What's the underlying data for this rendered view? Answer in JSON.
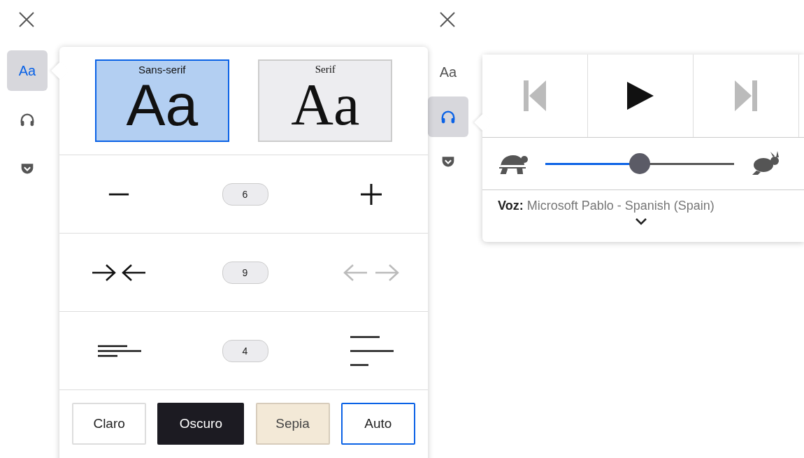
{
  "text_panel": {
    "sidebar": [
      {
        "kind": "text",
        "label": "Aa",
        "selected": true
      },
      {
        "kind": "headphones",
        "selected": false
      },
      {
        "kind": "pocket",
        "selected": false
      }
    ],
    "fonts": [
      {
        "kind": "sans",
        "label": "Sans-serif",
        "sample": "Aa",
        "selected": true
      },
      {
        "kind": "serif",
        "label": "Serif",
        "sample": "Aa",
        "selected": false
      }
    ],
    "steppers": [
      {
        "kind": "size",
        "value": "6",
        "decrease_disabled": false,
        "increase_disabled": false
      },
      {
        "kind": "width",
        "value": "9",
        "decrease_disabled": false,
        "increase_disabled": true
      },
      {
        "kind": "spacing",
        "value": "4",
        "decrease_disabled": false,
        "increase_disabled": false
      }
    ],
    "themes": [
      {
        "kind": "light",
        "label": "Claro",
        "selected": false
      },
      {
        "kind": "dark",
        "label": "Oscuro",
        "selected": false
      },
      {
        "kind": "sepia",
        "label": "Sepia",
        "selected": false
      },
      {
        "kind": "auto",
        "label": "Auto",
        "selected": true
      }
    ]
  },
  "audio_panel": {
    "sidebar": [
      {
        "kind": "text",
        "label": "Aa",
        "selected": false
      },
      {
        "kind": "headphones",
        "selected": true
      },
      {
        "kind": "pocket",
        "selected": false
      }
    ],
    "previous_disabled": true,
    "next_disabled": true,
    "speed": {
      "level": 0.5
    },
    "voice_label": "Voz:",
    "voice": "Microsoft Pablo - Spanish (Spain)"
  }
}
